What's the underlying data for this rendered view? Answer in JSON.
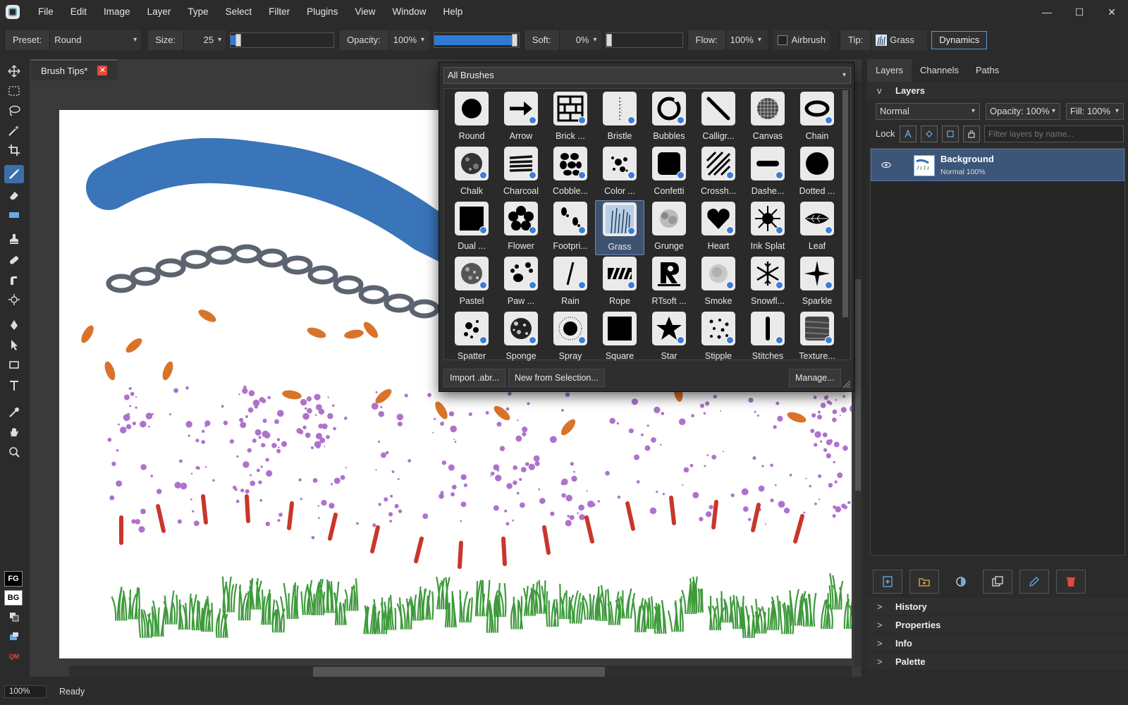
{
  "menubar": {
    "items": [
      "File",
      "Edit",
      "Image",
      "Layer",
      "Type",
      "Select",
      "Filter",
      "Plugins",
      "View",
      "Window",
      "Help"
    ]
  },
  "window_controls": {
    "minimize": "—",
    "maximize": "☐",
    "close": "✕"
  },
  "options": {
    "preset_label": "Preset:",
    "preset_value": "Round",
    "size_label": "Size:",
    "size_value": "25",
    "size_level": 0.05,
    "opacity_label": "Opacity:",
    "opacity_value": "100%",
    "opacity_level": 1.0,
    "soft_label": "Soft:",
    "soft_value": "0%",
    "soft_level": 0.0,
    "flow_label": "Flow:",
    "flow_value": "100%",
    "airbrush_label": "Airbrush",
    "airbrush_checked": false,
    "tip_label": "Tip:",
    "tip_value": "Grass",
    "dynamics_label": "Dynamics"
  },
  "toolbox": {
    "fg_label": "FG",
    "bg_label": "BG",
    "qm_label": "QM"
  },
  "document": {
    "tab_title": "Brush Tips*",
    "tab_close": "✕"
  },
  "brush_popup": {
    "category": "All Brushes",
    "brushes": [
      {
        "label": "Round",
        "icon": "round-brush-icon",
        "dot": false,
        "selected": false
      },
      {
        "label": "Arrow",
        "icon": "arrow-brush-icon",
        "dot": true,
        "selected": false
      },
      {
        "label": "Brick ...",
        "icon": "brick-brush-icon",
        "dot": true,
        "selected": false
      },
      {
        "label": "Bristle",
        "icon": "bristle-brush-icon",
        "dot": true,
        "selected": false
      },
      {
        "label": "Bubbles",
        "icon": "bubbles-brush-icon",
        "dot": true,
        "selected": false
      },
      {
        "label": "Calligr...",
        "icon": "calligraphy-brush-icon",
        "dot": false,
        "selected": false
      },
      {
        "label": "Canvas",
        "icon": "canvas-brush-icon",
        "dot": false,
        "selected": false
      },
      {
        "label": "Chain",
        "icon": "chain-brush-icon",
        "dot": true,
        "selected": false
      },
      {
        "label": "Chalk",
        "icon": "chalk-brush-icon",
        "dot": true,
        "selected": false
      },
      {
        "label": "Charcoal",
        "icon": "charcoal-brush-icon",
        "dot": true,
        "selected": false
      },
      {
        "label": "Cobble...",
        "icon": "cobblestone-brush-icon",
        "dot": true,
        "selected": false
      },
      {
        "label": "Color ...",
        "icon": "color-splatter-brush-icon",
        "dot": true,
        "selected": false
      },
      {
        "label": "Confetti",
        "icon": "confetti-brush-icon",
        "dot": true,
        "selected": false
      },
      {
        "label": "Crossh...",
        "icon": "crosshatch-brush-icon",
        "dot": true,
        "selected": false
      },
      {
        "label": "Dashe...",
        "icon": "dashed-brush-icon",
        "dot": true,
        "selected": false
      },
      {
        "label": "Dotted ...",
        "icon": "dotted-brush-icon",
        "dot": false,
        "selected": false
      },
      {
        "label": "Dual ...",
        "icon": "dual-brush-icon",
        "dot": true,
        "selected": false
      },
      {
        "label": "Flower",
        "icon": "flower-brush-icon",
        "dot": true,
        "selected": false
      },
      {
        "label": "Footpri...",
        "icon": "footprint-brush-icon",
        "dot": true,
        "selected": false
      },
      {
        "label": "Grass",
        "icon": "grass-brush-icon",
        "dot": true,
        "selected": true
      },
      {
        "label": "Grunge",
        "icon": "grunge-brush-icon",
        "dot": false,
        "selected": false
      },
      {
        "label": "Heart",
        "icon": "heart-brush-icon",
        "dot": true,
        "selected": false
      },
      {
        "label": "Ink Splat",
        "icon": "ink-splat-brush-icon",
        "dot": true,
        "selected": false
      },
      {
        "label": "Leaf",
        "icon": "leaf-brush-icon",
        "dot": true,
        "selected": false
      },
      {
        "label": "Pastel",
        "icon": "pastel-brush-icon",
        "dot": true,
        "selected": false
      },
      {
        "label": "Paw ...",
        "icon": "paw-brush-icon",
        "dot": true,
        "selected": false
      },
      {
        "label": "Rain",
        "icon": "rain-brush-icon",
        "dot": true,
        "selected": false
      },
      {
        "label": "Rope",
        "icon": "rope-brush-icon",
        "dot": true,
        "selected": false
      },
      {
        "label": "RTsoft ...",
        "icon": "rtsoft-logo-brush-icon",
        "dot": false,
        "selected": false
      },
      {
        "label": "Smoke",
        "icon": "smoke-brush-icon",
        "dot": true,
        "selected": false
      },
      {
        "label": "Snowfl...",
        "icon": "snowflake-brush-icon",
        "dot": true,
        "selected": false
      },
      {
        "label": "Sparkle",
        "icon": "sparkle-brush-icon",
        "dot": true,
        "selected": false
      },
      {
        "label": "Spatter",
        "icon": "spatter-brush-icon",
        "dot": true,
        "selected": false
      },
      {
        "label": "Sponge",
        "icon": "sponge-brush-icon",
        "dot": true,
        "selected": false
      },
      {
        "label": "Spray",
        "icon": "spray-brush-icon",
        "dot": true,
        "selected": false
      },
      {
        "label": "Square",
        "icon": "square-brush-icon",
        "dot": false,
        "selected": false
      },
      {
        "label": "Star",
        "icon": "star-brush-icon",
        "dot": true,
        "selected": false
      },
      {
        "label": "Stipple",
        "icon": "stipple-brush-icon",
        "dot": true,
        "selected": false
      },
      {
        "label": "Stitches",
        "icon": "stitches-brush-icon",
        "dot": true,
        "selected": false
      },
      {
        "label": "Texture...",
        "icon": "texture-brush-icon",
        "dot": true,
        "selected": false
      }
    ],
    "import_label": "Import .abr...",
    "new_from_selection_label": "New from Selection...",
    "manage_label": "Manage..."
  },
  "right_panel": {
    "tabs": [
      "Layers",
      "Channels",
      "Paths"
    ],
    "layers_section_title": "Layers",
    "layers_section_chevron": "v",
    "blend_mode": "Normal",
    "opacity": "Opacity: 100%",
    "fill": "Fill: 100%",
    "lock_label": "Lock",
    "filter_placeholder": "Filter layers by name...",
    "layers": [
      {
        "name": "Background",
        "meta": "Normal  100%"
      }
    ],
    "collapsed_sections": [
      "History",
      "Properties",
      "Info",
      "Palette"
    ],
    "collapsed_chevron": ">"
  },
  "statusbar": {
    "zoom": "100%",
    "status": "Ready"
  },
  "colors": {
    "accent": "#2d7bd6",
    "selection": "#3c5679",
    "stroke_blue": "#2f6db5",
    "chain": "#5c6470",
    "leaf": "#d9732a",
    "splatter": "#9b4fc0",
    "dash": "#c9362b",
    "grass": "#3f9a3c"
  }
}
